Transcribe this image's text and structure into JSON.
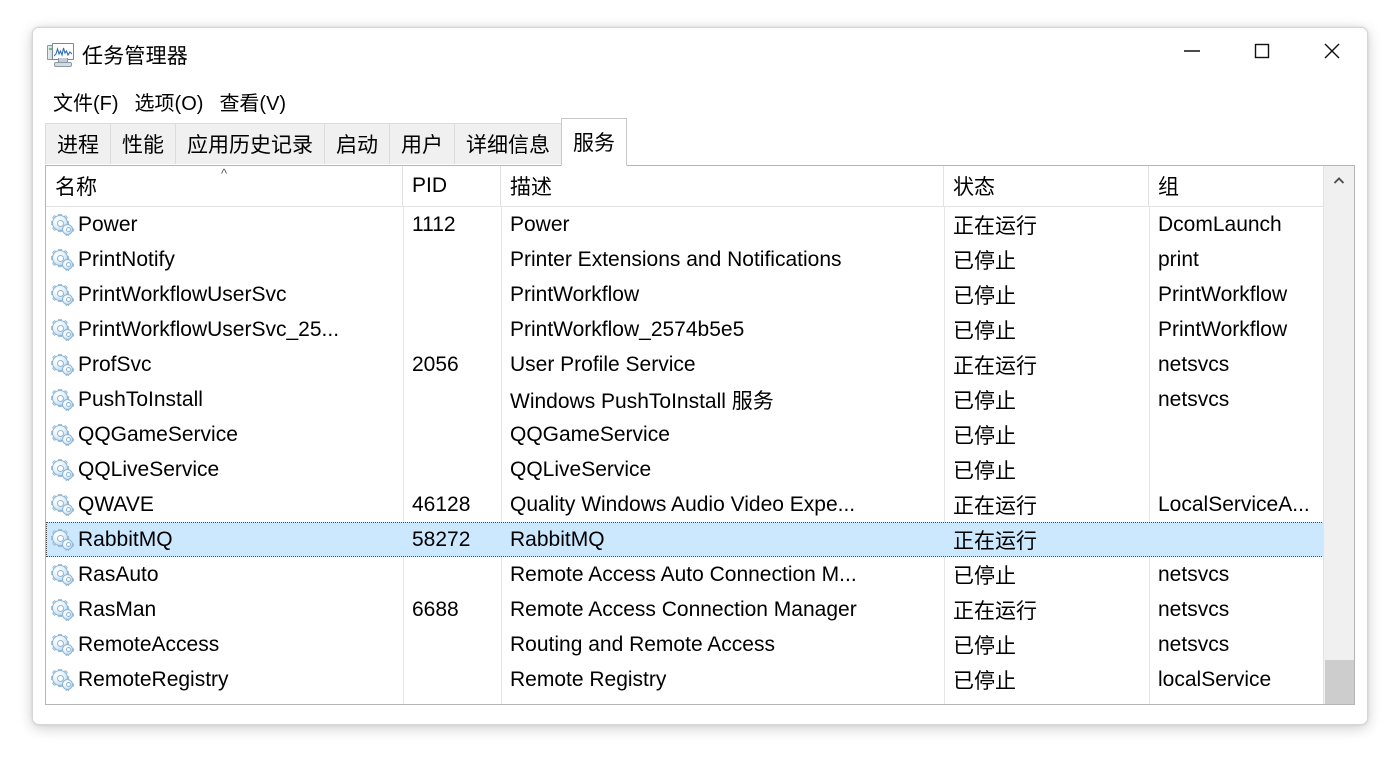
{
  "window": {
    "title": "任务管理器",
    "icon": "task-manager-icon",
    "controls": {
      "minimize": "最小化",
      "maximize": "最大化",
      "close": "关闭"
    }
  },
  "menubar": {
    "items": [
      {
        "label": "文件(F)",
        "name": "menu-file"
      },
      {
        "label": "选项(O)",
        "name": "menu-options"
      },
      {
        "label": "查看(V)",
        "name": "menu-view"
      }
    ]
  },
  "tabs": [
    {
      "label": "进程",
      "name": "tab-processes",
      "active": false
    },
    {
      "label": "性能",
      "name": "tab-performance",
      "active": false
    },
    {
      "label": "应用历史记录",
      "name": "tab-app-history",
      "active": false
    },
    {
      "label": "启动",
      "name": "tab-startup",
      "active": false
    },
    {
      "label": "用户",
      "name": "tab-users",
      "active": false
    },
    {
      "label": "详细信息",
      "name": "tab-details",
      "active": false
    },
    {
      "label": "服务",
      "name": "tab-services",
      "active": true
    }
  ],
  "table": {
    "columns": [
      {
        "key": "name",
        "label": "名称",
        "sorted": "asc",
        "sort_glyph": "^"
      },
      {
        "key": "pid",
        "label": "PID",
        "sorted": "none"
      },
      {
        "key": "description",
        "label": "描述",
        "sorted": "none"
      },
      {
        "key": "status",
        "label": "状态",
        "sorted": "none"
      },
      {
        "key": "group",
        "label": "组",
        "sorted": "none"
      }
    ],
    "rows": [
      {
        "name": "Power",
        "pid": "1112",
        "description": "Power",
        "status": "正在运行",
        "group": "DcomLaunch",
        "selected": false
      },
      {
        "name": "PrintNotify",
        "pid": "",
        "description": "Printer Extensions and Notifications",
        "status": "已停止",
        "group": "print",
        "selected": false
      },
      {
        "name": "PrintWorkflowUserSvc",
        "pid": "",
        "description": "PrintWorkflow",
        "status": "已停止",
        "group": "PrintWorkflow",
        "selected": false
      },
      {
        "name": "PrintWorkflowUserSvc_25...",
        "pid": "",
        "description": "PrintWorkflow_2574b5e5",
        "status": "已停止",
        "group": "PrintWorkflow",
        "selected": false
      },
      {
        "name": "ProfSvc",
        "pid": "2056",
        "description": "User Profile Service",
        "status": "正在运行",
        "group": "netsvcs",
        "selected": false
      },
      {
        "name": "PushToInstall",
        "pid": "",
        "description": "Windows PushToInstall 服务",
        "status": "已停止",
        "group": "netsvcs",
        "selected": false
      },
      {
        "name": "QQGameService",
        "pid": "",
        "description": "QQGameService",
        "status": "已停止",
        "group": "",
        "selected": false
      },
      {
        "name": "QQLiveService",
        "pid": "",
        "description": "QQLiveService",
        "status": "已停止",
        "group": "",
        "selected": false
      },
      {
        "name": "QWAVE",
        "pid": "46128",
        "description": "Quality Windows Audio Video Expe...",
        "status": "正在运行",
        "group": "LocalServiceA...",
        "selected": false
      },
      {
        "name": "RabbitMQ",
        "pid": "58272",
        "description": "RabbitMQ",
        "status": "正在运行",
        "group": "",
        "selected": true
      },
      {
        "name": "RasAuto",
        "pid": "",
        "description": "Remote Access Auto Connection M...",
        "status": "已停止",
        "group": "netsvcs",
        "selected": false
      },
      {
        "name": "RasMan",
        "pid": "6688",
        "description": "Remote Access Connection Manager",
        "status": "正在运行",
        "group": "netsvcs",
        "selected": false
      },
      {
        "name": "RemoteAccess",
        "pid": "",
        "description": "Routing and Remote Access",
        "status": "已停止",
        "group": "netsvcs",
        "selected": false
      },
      {
        "name": "RemoteRegistry",
        "pid": "",
        "description": "Remote Registry",
        "status": "已停止",
        "group": "localService",
        "selected": false
      }
    ]
  },
  "scrollbar": {
    "up_arrow": "scroll-up-icon",
    "thumb_name": "scroll-thumb"
  },
  "colors": {
    "selection": "#cce8ff",
    "window_bg": "#ffffff",
    "tab_inactive": "#f0f0f0",
    "border": "#b5b5b5",
    "scroll_track": "#f0f0f0",
    "scroll_thumb": "#cdcdcd"
  }
}
